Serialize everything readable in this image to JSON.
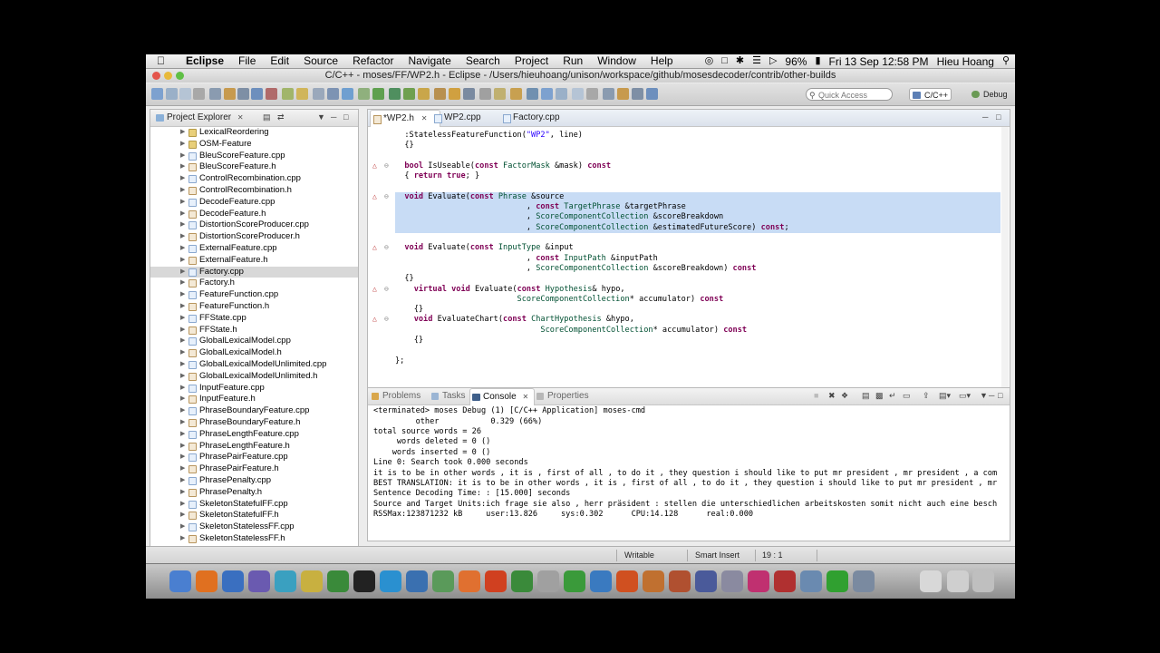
{
  "menubar": {
    "app_name": "Eclipse",
    "menus": [
      "File",
      "Edit",
      "Source",
      "Refactor",
      "Navigate",
      "Search",
      "Project",
      "Run",
      "Window",
      "Help"
    ],
    "battery": "96%",
    "clock": "Fri 13 Sep  12:58 PM",
    "user": "Hieu Hoang"
  },
  "window": {
    "title": "C/C++ - moses/FF/WP2.h - Eclipse - /Users/hieuhoang/unison/workspace/github/mosesdecoder/contrib/other-builds"
  },
  "toolbar": {
    "quick_access_placeholder": "Quick Access",
    "perspective_cpp": "C/C++",
    "perspective_debug": "Debug"
  },
  "explorer": {
    "title": "Project Explorer",
    "items": [
      {
        "label": "LexicalReordering",
        "kind": "folder"
      },
      {
        "label": "OSM-Feature",
        "kind": "folder"
      },
      {
        "label": "BleuScoreFeature.cpp",
        "kind": "cpp"
      },
      {
        "label": "BleuScoreFeature.h",
        "kind": "h"
      },
      {
        "label": "ControlRecombination.cpp",
        "kind": "cpp"
      },
      {
        "label": "ControlRecombination.h",
        "kind": "h"
      },
      {
        "label": "DecodeFeature.cpp",
        "kind": "cpp"
      },
      {
        "label": "DecodeFeature.h",
        "kind": "h"
      },
      {
        "label": "DistortionScoreProducer.cpp",
        "kind": "cpp"
      },
      {
        "label": "DistortionScoreProducer.h",
        "kind": "h"
      },
      {
        "label": "ExternalFeature.cpp",
        "kind": "cpp"
      },
      {
        "label": "ExternalFeature.h",
        "kind": "h"
      },
      {
        "label": "Factory.cpp",
        "kind": "cpp",
        "selected": true
      },
      {
        "label": "Factory.h",
        "kind": "h"
      },
      {
        "label": "FeatureFunction.cpp",
        "kind": "cpp"
      },
      {
        "label": "FeatureFunction.h",
        "kind": "h"
      },
      {
        "label": "FFState.cpp",
        "kind": "cpp"
      },
      {
        "label": "FFState.h",
        "kind": "h"
      },
      {
        "label": "GlobalLexicalModel.cpp",
        "kind": "cpp"
      },
      {
        "label": "GlobalLexicalModel.h",
        "kind": "h"
      },
      {
        "label": "GlobalLexicalModelUnlimited.cpp",
        "kind": "cpp"
      },
      {
        "label": "GlobalLexicalModelUnlimited.h",
        "kind": "h"
      },
      {
        "label": "InputFeature.cpp",
        "kind": "cpp"
      },
      {
        "label": "InputFeature.h",
        "kind": "h"
      },
      {
        "label": "PhraseBoundaryFeature.cpp",
        "kind": "cpp"
      },
      {
        "label": "PhraseBoundaryFeature.h",
        "kind": "h"
      },
      {
        "label": "PhraseLengthFeature.cpp",
        "kind": "cpp"
      },
      {
        "label": "PhraseLengthFeature.h",
        "kind": "h"
      },
      {
        "label": "PhrasePairFeature.cpp",
        "kind": "cpp"
      },
      {
        "label": "PhrasePairFeature.h",
        "kind": "h"
      },
      {
        "label": "PhrasePenalty.cpp",
        "kind": "cpp"
      },
      {
        "label": "PhrasePenalty.h",
        "kind": "h"
      },
      {
        "label": "SkeletonStatefulFF.cpp",
        "kind": "cpp"
      },
      {
        "label": "SkeletonStatefulFF.h",
        "kind": "h"
      },
      {
        "label": "SkeletonStatelessFF.cpp",
        "kind": "cpp"
      },
      {
        "label": "SkeletonStatelessFF.h",
        "kind": "h"
      }
    ]
  },
  "editor": {
    "tabs": [
      "*WP2.h",
      "WP2.cpp",
      "Factory.cpp"
    ],
    "lines": [
      {
        "text": "  :StatelessFeatureFunction(\"WP2\", line)",
        "hl": false
      },
      {
        "text": "  {}",
        "hl": false
      },
      {
        "text": "",
        "hl": false
      },
      {
        "text": "  bool IsUseable(const FactorMask &mask) const",
        "hl": false
      },
      {
        "text": "  { return true; }",
        "hl": false
      },
      {
        "text": "",
        "hl": false
      },
      {
        "text": "  void Evaluate(const Phrase &source",
        "hl": true
      },
      {
        "text": "                            , const TargetPhrase &targetPhrase",
        "hl": true
      },
      {
        "text": "                            , ScoreComponentCollection &scoreBreakdown",
        "hl": true
      },
      {
        "text": "                            , ScoreComponentCollection &estimatedFutureScore) const;",
        "hl": true
      },
      {
        "text": "",
        "hl": false
      },
      {
        "text": "  void Evaluate(const InputType &input",
        "hl": false
      },
      {
        "text": "                            , const InputPath &inputPath",
        "hl": false
      },
      {
        "text": "                            , ScoreComponentCollection &scoreBreakdown) const",
        "hl": false
      },
      {
        "text": "  {}",
        "hl": false
      },
      {
        "text": "    virtual void Evaluate(const Hypothesis& hypo,",
        "hl": false
      },
      {
        "text": "                          ScoreComponentCollection* accumulator) const",
        "hl": false
      },
      {
        "text": "    {}",
        "hl": false
      },
      {
        "text": "    void EvaluateChart(const ChartHypothesis &hypo,",
        "hl": false
      },
      {
        "text": "                               ScoreComponentCollection* accumulator) const",
        "hl": false
      },
      {
        "text": "    {}",
        "hl": false
      },
      {
        "text": "",
        "hl": false
      },
      {
        "text": "};",
        "hl": false
      }
    ]
  },
  "console": {
    "tabs": [
      "Problems",
      "Tasks",
      "Console",
      "Properties"
    ],
    "header": "<terminated> moses Debug (1) [C/C++ Application] moses-cmd",
    "lines": [
      "         other           0.329 (66%)",
      "total source words = 26",
      "     words deleted = 0 ()",
      "    words inserted = 0 ()",
      "Line 0: Search took 0.000 seconds",
      "it is to be in other words , it is , first of all , to do it , they question i should like to put mr president , mr president , a com",
      "BEST TRANSLATION: it is to be in other words , it is , first of all , to do it , they question i should like to put mr president , mr",
      "Sentence Decoding Time: : [15.000] seconds",
      "Source and Target Units:ich frage sie also , herr präsident : stellen die unterschiedlichen arbeitskosten somit nicht auch eine besch",
      "RSSMax:123871232 kB     user:13.826     sys:0.302      CPU:14.128      real:0.000"
    ]
  },
  "status": {
    "writable": "Writable",
    "insert_mode": "Smart Insert",
    "position": "19 : 1"
  },
  "colors": {
    "highlight": "#c8dcf5",
    "keyword": "#7f0055",
    "type": "#005032",
    "string": "#2a00ff"
  }
}
